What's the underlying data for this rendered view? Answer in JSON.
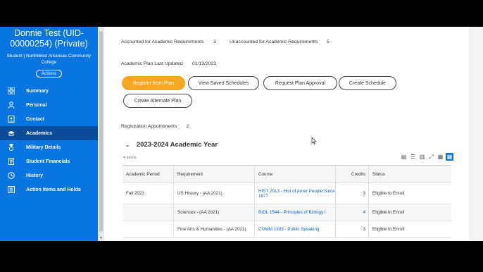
{
  "sidebar": {
    "name": "Donnie Test (UID-00000254) (Private)",
    "subtitle": "Student | NorthWest Arkansas Community College",
    "actions_label": "Actions",
    "items": [
      {
        "label": "Summary",
        "icon": "grid-icon"
      },
      {
        "label": "Personal",
        "icon": "person-icon"
      },
      {
        "label": "Contact",
        "icon": "contact-card-icon"
      },
      {
        "label": "Academics",
        "icon": "academic-cap-icon"
      },
      {
        "label": "Military Details",
        "icon": "medal-icon"
      },
      {
        "label": "Student Financials",
        "icon": "document-icon"
      },
      {
        "label": "History",
        "icon": "clock-icon"
      },
      {
        "label": "Action Items and Holds",
        "icon": "bars-icon"
      }
    ]
  },
  "main": {
    "accounted_label": "Accounted for Academic Requirements",
    "accounted_value": "3",
    "unaccounted_label": "Unaccounted for Academic Requirements",
    "unaccounted_value": "5",
    "plan_updated_label": "Academic Plan Last Updated",
    "plan_updated_value": "01/13/2023",
    "buttons": {
      "register": "Register from Plan",
      "view_saved": "View Saved Schedules",
      "request_plan": "Request Plan Approval",
      "create_schedule": "Create Schedule",
      "create_alternate": "Create Alternate Plan"
    },
    "registration_label": "Registration Appointments",
    "registration_value": "2",
    "year_title": "2023-2024 Academic Year",
    "items_count": "4 items",
    "columns": [
      "Academic Period",
      "Requirement",
      "Course",
      "Credits",
      "Status"
    ],
    "rows": [
      {
        "period": "Fall 2023",
        "requirement": "US History - (AA 2021)",
        "course": "HIST 2013 - Hist of Amer People Since 1877",
        "credits": "3",
        "status": "Eligible to Enroll"
      },
      {
        "period": "",
        "requirement": "Sciences - (AA 2021)",
        "course": "BIOL 1544 - Principles of Biology I",
        "credits": "4",
        "status": "Eligible to Enroll"
      },
      {
        "period": "",
        "requirement": "Fine Arts & Humanities - (AA 2021)",
        "course": "COMM 1303 - Public Speaking",
        "credits": "3",
        "status": "Eligible to Enroll"
      }
    ]
  },
  "colors": {
    "sidebar": "#0875e1",
    "sidebar_active": "#0a4c9a",
    "primary_button": "#f5a623",
    "link": "#0b64c0"
  }
}
